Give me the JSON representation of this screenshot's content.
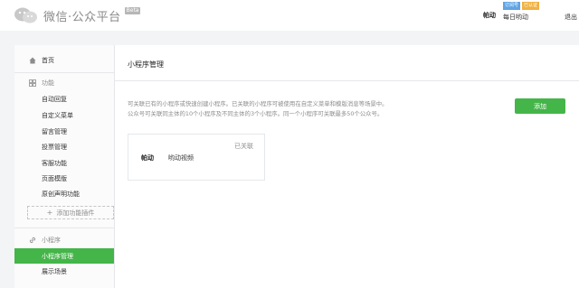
{
  "header": {
    "logo_text": "微信·公众平台",
    "beta_label": "Beta",
    "account_label": "帕动",
    "tags": [
      "订阅号",
      "已认证"
    ],
    "account_name": "每日哟动",
    "exit_label": "退出"
  },
  "sidebar": {
    "home_label": "首页",
    "features_label": "功能",
    "feature_items": [
      "自动回复",
      "自定义菜单",
      "留言管理",
      "投票管理",
      "客服功能",
      "页面模版",
      "原创声明功能"
    ],
    "add_plugin_label": "添加功能插件",
    "miniprogram_label": "小程序",
    "miniprogram_items": [
      "小程序管理",
      "展示场景"
    ]
  },
  "main": {
    "title": "小程序管理",
    "desc_line1": "可关联已有的小程序或快速创建小程序。已关联的小程序可被使用在自定义菜单和模版消息等场景中。",
    "desc_line2": "公众号可关联同主体的10个小程序及不同主体的3个小程序。同一个小程序可关联最多50个公众号。",
    "add_button": "添加",
    "card": {
      "status": "已关联",
      "name": "帕动",
      "subtitle": "哟动视频"
    }
  },
  "colors": {
    "accent": "#44b549",
    "tag_blue": "#61a4e4",
    "tag_orange": "#f0b243"
  }
}
